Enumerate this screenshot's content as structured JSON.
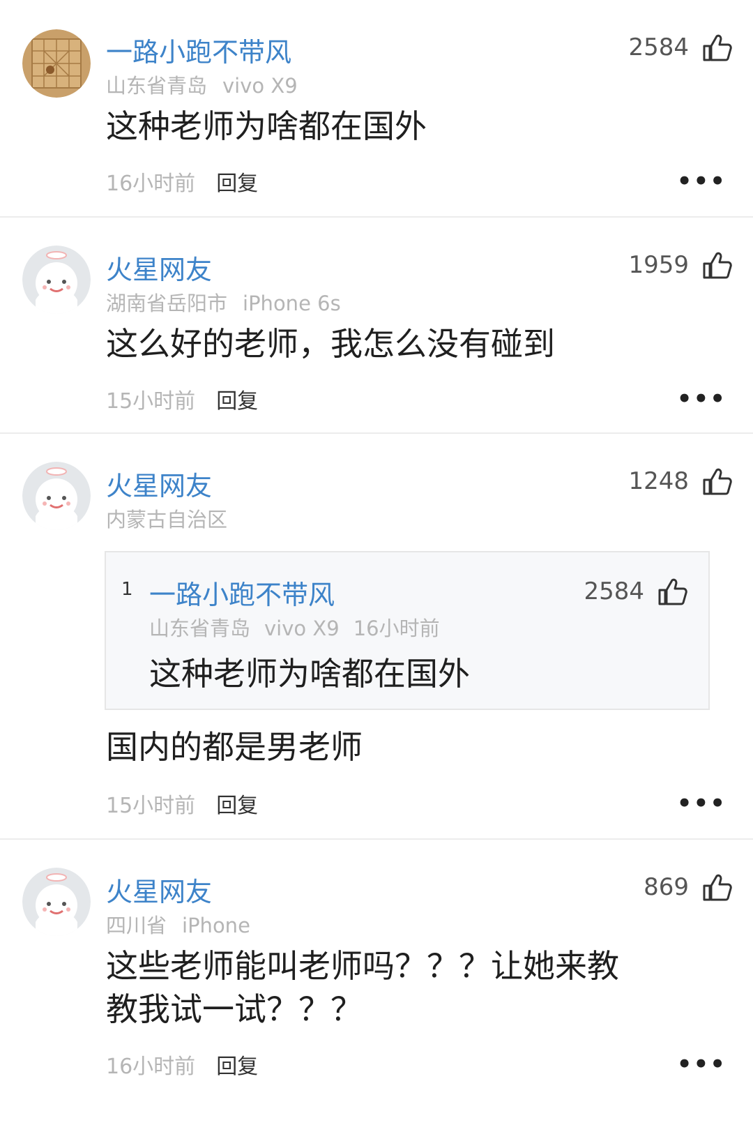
{
  "comments": [
    {
      "username": "一路小跑不带风",
      "location": "山东省青岛",
      "device": "vivo X9",
      "likes": "2584",
      "text": "这种老师为啥都在国外",
      "time": "16小时前",
      "reply_label": "回复",
      "more_label": "•••",
      "avatar": "board-game-avatar"
    },
    {
      "username": "火星网友",
      "location": "湖南省岳阳市",
      "device": "iPhone 6s",
      "likes": "1959",
      "text": "这么好的老师，我怎么没有碰到",
      "time": "15小时前",
      "reply_label": "回复",
      "more_label": "•••",
      "avatar": "default-face-avatar"
    },
    {
      "username": "火星网友",
      "location": "内蒙古自治区",
      "likes": "1248",
      "quote": {
        "index": "1",
        "username": "一路小跑不带风",
        "location": "山东省青岛",
        "device": "vivo X9",
        "time": "16小时前",
        "likes": "2584",
        "text": "这种老师为啥都在国外"
      },
      "text": "国内的都是男老师",
      "time": "15小时前",
      "reply_label": "回复",
      "more_label": "•••",
      "avatar": "default-face-avatar"
    },
    {
      "username": "火星网友",
      "location": "四川省",
      "device": "iPhone",
      "likes": "869",
      "text_line1": "这些老师能叫老师吗？？？让她来教",
      "text_line2": "教我试一试？？？",
      "time": "16小时前",
      "reply_label": "回复",
      "more_label": "•••",
      "avatar": "default-face-avatar"
    }
  ],
  "colors": {
    "username": "#3d83c9",
    "meta": "#b5b5b5",
    "divider": "#ececec"
  }
}
